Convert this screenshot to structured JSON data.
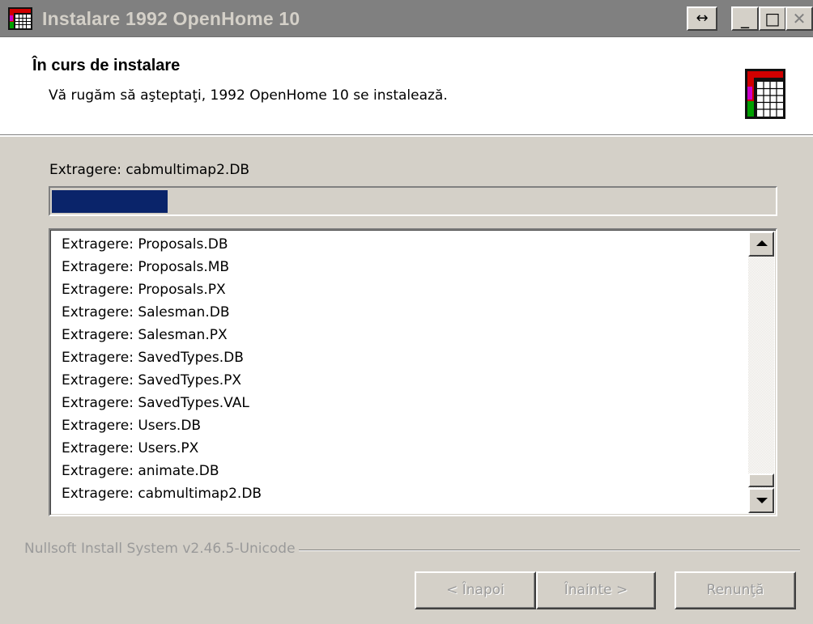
{
  "window": {
    "title": "Instalare 1992 OpenHome 10",
    "controls": {
      "resize": "↔",
      "minimize": "_",
      "maximize": "□",
      "close": "✕"
    }
  },
  "header": {
    "title": "În curs de instalare",
    "subtitle": "Vă rugăm să aşteptaţi, 1992 OpenHome 10 se instalează.",
    "icon": "installer-icon"
  },
  "main": {
    "status": "Extragere: cabmultimap2.DB",
    "progress_fraction": 0.16,
    "progress_color": "#0a246a",
    "log": [
      "Extragere: Proposals.DB",
      "Extragere: Proposals.MB",
      "Extragere: Proposals.PX",
      "Extragere: Salesman.DB",
      "Extragere: Salesman.PX",
      "Extragere: SavedTypes.DB",
      "Extragere: SavedTypes.PX",
      "Extragere: SavedTypes.VAL",
      "Extragere: Users.DB",
      "Extragere: Users.PX",
      "Extragere: animate.DB",
      "Extragere: cabmultimap2.DB"
    ]
  },
  "footer": {
    "branding": "Nullsoft Install System v2.46.5-Unicode",
    "buttons": {
      "back": "< Înapoi",
      "next": "Înainte >",
      "cancel": "Renunţă"
    }
  }
}
